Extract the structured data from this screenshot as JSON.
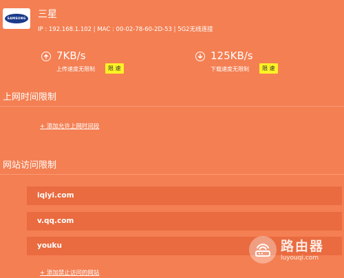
{
  "device": {
    "logo_text": "SAMSUNG",
    "name": "三星",
    "info": "IP : 192.168.1.102 | MAC : 00-02-78-60-2D-53 | 5G2无线连接"
  },
  "upload": {
    "icon": "arrow-up-icon",
    "value": "7KB/s",
    "note": "上传速度无限制",
    "button_label": "限 速"
  },
  "download": {
    "icon": "arrow-down-icon",
    "value": "125KB/s",
    "note": "下载速度无限制",
    "button_label": "限 速"
  },
  "time_limit": {
    "title": "上网时间限制",
    "add_link": "+ 添加允许上网时间段"
  },
  "site_limit": {
    "title": "网站访问限制",
    "sites": [
      "iqiyi.com",
      "v.qq.com",
      "youku"
    ],
    "add_link": "+ 添加禁止访问的网站"
  },
  "watermark": {
    "icon": "router-logo-icon",
    "title": "路由器",
    "subtitle": "luyouqi.com"
  },
  "colors": {
    "background": "#f47f52",
    "row": "#e96b3f",
    "button": "#fdf225",
    "text": "#ffffff"
  }
}
